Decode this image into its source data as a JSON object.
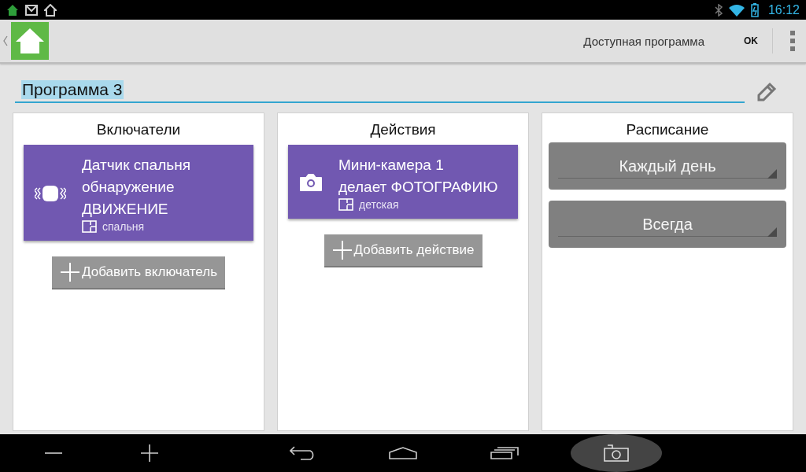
{
  "status_bar": {
    "time": "16:12"
  },
  "action_bar": {
    "action_label": "Доступная программа",
    "ok_button": "OK"
  },
  "program_name": {
    "value": "Программа 3"
  },
  "columns": [
    {
      "kind": "cards",
      "title": "Включатели",
      "cards": [
        {
          "kind": "motion-sensor",
          "lines": [
            "Датчик спальня",
            "обнаружение",
            "ДВИЖЕНИЕ"
          ],
          "room": "спальня"
        }
      ],
      "add_button": "Добавить включатель"
    },
    {
      "kind": "cards",
      "title": "Действия",
      "cards": [
        {
          "kind": "camera",
          "lines": [
            "Мини-камера 1",
            "делает ФОТОГРАФИЮ"
          ],
          "room": "детская"
        }
      ],
      "add_button": "Добавить действие"
    },
    {
      "kind": "dropdowns",
      "title": "Расписание",
      "dropdowns": [
        "Каждый день",
        "Всегда"
      ]
    }
  ]
}
